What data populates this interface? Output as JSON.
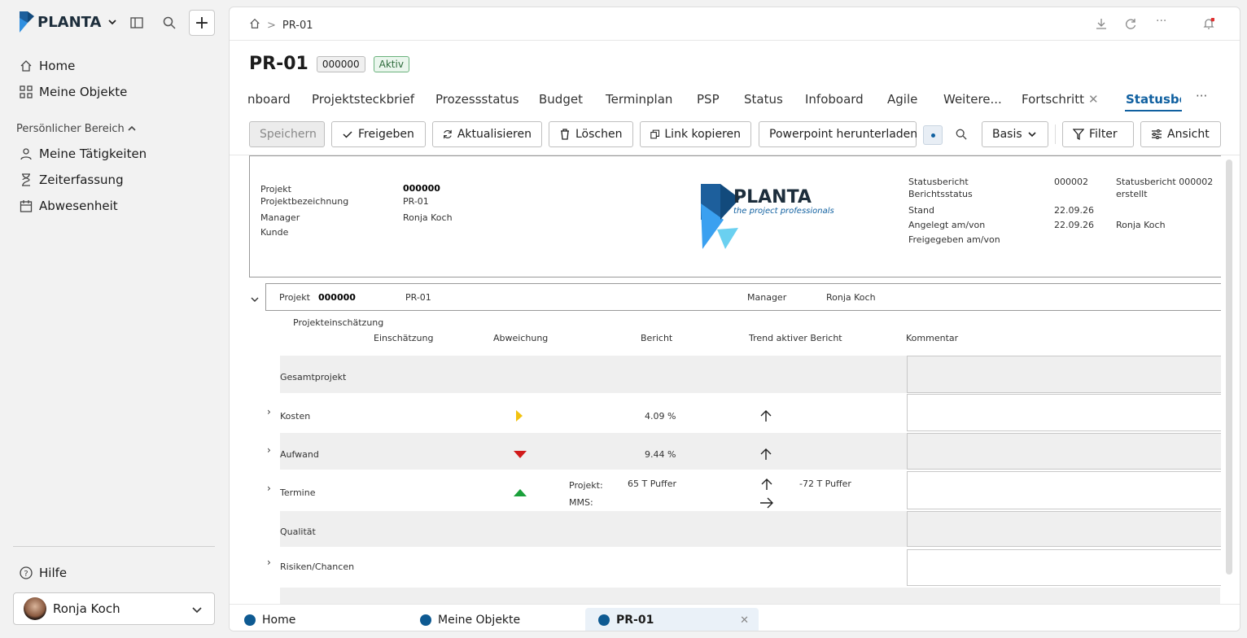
{
  "app": {
    "brand": "PLANTA"
  },
  "sidebar": {
    "nav": [
      {
        "label": "Home",
        "icon": "home-icon"
      },
      {
        "label": "Meine Objekte",
        "icon": "grid-icon"
      }
    ],
    "group_label": "Persönlicher Bereich",
    "personal": [
      {
        "label": "Meine Tätigkeiten",
        "icon": "person-icon"
      },
      {
        "label": "Zeiterfassung",
        "icon": "hourglass-icon"
      },
      {
        "label": "Abwesenheit",
        "icon": "calendar-icon"
      }
    ],
    "help": "Hilfe",
    "user": "Ronja Koch"
  },
  "breadcrumb": {
    "current": "PR-01"
  },
  "header": {
    "title": "PR-01",
    "id_badge": "000000",
    "status_badge": "Aktiv"
  },
  "tabs": [
    "nboard",
    "Projektsteckbrief",
    "Prozessstatus",
    "Budget",
    "Terminplan",
    "PSP",
    "Status",
    "Infoboard",
    "Agile",
    "Weitere...",
    "Fortschritt",
    "Statusberi"
  ],
  "toolbar": {
    "save": "Speichern",
    "release": "Freigeben",
    "refresh": "Aktualisieren",
    "delete": "Löschen",
    "copy_link": "Link kopieren",
    "ppt": "Powerpoint herunterladen",
    "basis": "Basis",
    "filter": "Filter",
    "view": "Ansicht"
  },
  "report_header": {
    "labels": [
      "Projekt",
      "Projektbezeichnung",
      "Manager",
      "Kunde"
    ],
    "values": {
      "projekt": "000000",
      "bezeichnung": "PR-01",
      "manager": "Ronja Koch"
    },
    "logo_text": "PLANTA",
    "logo_tagline": "the project professionals",
    "right_labels": [
      "Statusbericht",
      "Berichtsstatus",
      "Stand",
      "Angelegt am/von",
      "Freigegeben am/von"
    ],
    "right": {
      "statusbericht": "000002",
      "statusbericht_text": "Statusbericht 000002",
      "berichtsstatus": "erstellt",
      "stand": "22.09.26",
      "angelegt": "22.09.26",
      "angelegt_von": "Ronja Koch"
    }
  },
  "project_row": {
    "label": "Projekt",
    "id": "000000",
    "name": "PR-01",
    "manager_label": "Manager",
    "manager": "Ronja Koch"
  },
  "assessment": {
    "title": "Projekteinschätzung",
    "columns": [
      "Einschätzung",
      "Abweichung",
      "Bericht",
      "Trend aktiver Bericht",
      "Kommentar"
    ],
    "rows": [
      {
        "name": "Gesamtprojekt"
      },
      {
        "name": "Kosten",
        "bericht": "4.09 %",
        "indicator": "yellow-right"
      },
      {
        "name": "Aufwand",
        "bericht": "9.44 %",
        "indicator": "red-down"
      },
      {
        "name": "Termine",
        "projekt_label": "Projekt:",
        "mms_label": "MMS:",
        "projekt_value": "65 T Puffer",
        "trend_value": "-72 T Puffer",
        "indicator": "green-up"
      },
      {
        "name": "Qualität"
      },
      {
        "name": "Risiken/Chancen"
      }
    ]
  },
  "bottom_tabs": [
    "Home",
    "Meine Objekte",
    "PR-01"
  ]
}
